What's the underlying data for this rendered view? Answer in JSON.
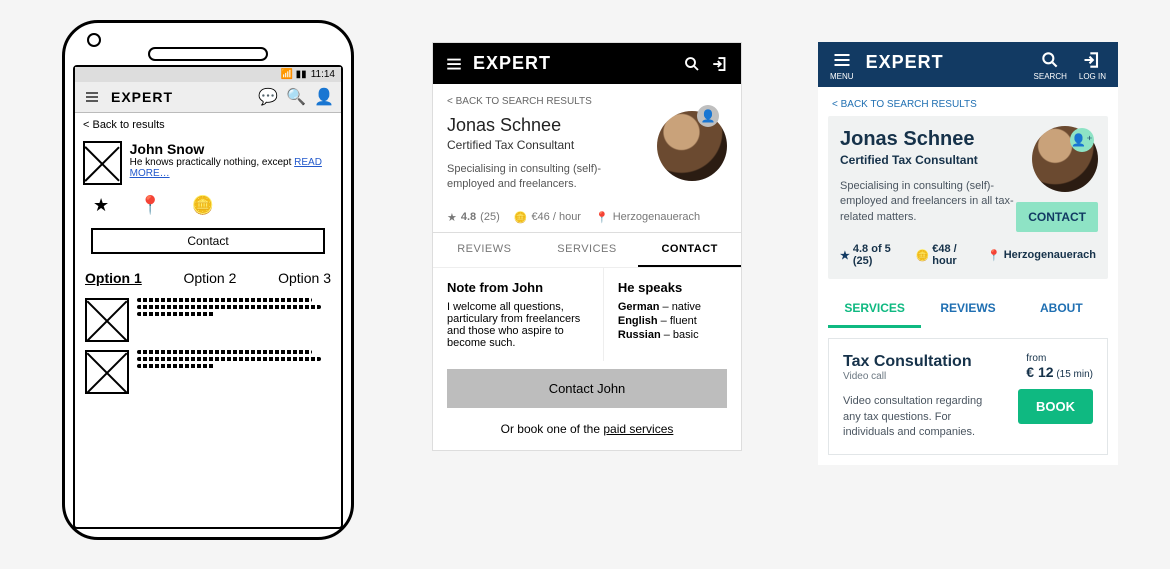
{
  "wireframe": {
    "status_time": "11:14",
    "brand": "EXPERT",
    "back_label": "< Back to results",
    "profile": {
      "name": "John Snow",
      "desc_prefix": "He knows practically nothing, except ",
      "read_more": "READ MORE…"
    },
    "contact_label": "Contact",
    "tabs": [
      "Option 1",
      "Option 2",
      "Option 3"
    ]
  },
  "panelB": {
    "brand": "EXPERT",
    "back_label": "< BACK TO SEARCH RESULTS",
    "profile": {
      "name": "Jonas Schnee",
      "title": "Certified Tax Consultant",
      "bio": "Specialising in consulting (self)-employed and freelancers."
    },
    "stats": {
      "rating_value": "4.8",
      "rating_count": "(25)",
      "rate": "€46 / hour",
      "location": "Herzogenauerach"
    },
    "tabs": {
      "reviews": "REVIEWS",
      "services": "SERVICES",
      "contact": "CONTACT"
    },
    "note": {
      "heading": "Note from John",
      "body": "I welcome all questions, particulary from freelancers and those who aspire to become such."
    },
    "languages": {
      "heading": "He speaks",
      "items": [
        {
          "lang": "German",
          "level": "native"
        },
        {
          "lang": "English",
          "level": "fluent"
        },
        {
          "lang": "Russian",
          "level": "basic"
        }
      ]
    },
    "contact_button": "Contact John",
    "or_prefix": "Or book one of the ",
    "or_link": "paid services"
  },
  "panelC": {
    "brand": "EXPERT",
    "header_labels": {
      "menu": "MENU",
      "search": "SEARCH",
      "login": "LOG IN"
    },
    "back_label": "< BACK TO SEARCH RESULTS",
    "profile": {
      "name": "Jonas Schnee",
      "title": "Certified Tax Consultant",
      "bio": "Specialising in consulting (self)-employed and freelancers in all tax-related matters."
    },
    "contact_button": "CONTACT",
    "stats": {
      "rating_text": "4.8 of 5 (25)",
      "rate": "€48 / hour",
      "location": "Herzogenauerach"
    },
    "tabs": {
      "services": "SERVICES",
      "reviews": "REVIEWS",
      "about": "ABOUT"
    },
    "service": {
      "name": "Tax Consultation",
      "subtype": "Video call",
      "desc": "Video consultation regarding any tax questions. For individuals and companies.",
      "price_from_label": "from",
      "price_value": "€ 12",
      "price_unit": "(15 min)",
      "book_label": "BOOK"
    }
  }
}
